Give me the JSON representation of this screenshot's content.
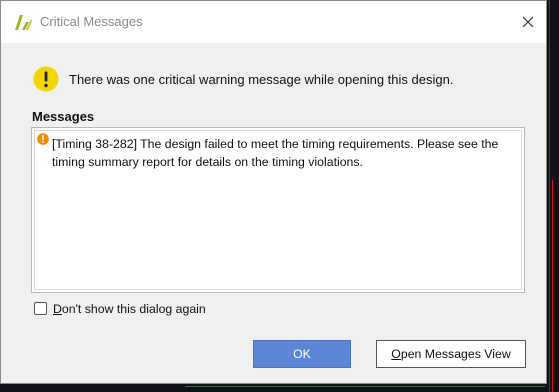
{
  "window": {
    "title": "Critical Messages",
    "close_icon": "close-icon",
    "logo_icon": "vivado-logo-icon"
  },
  "summary": {
    "icon": "warning-icon",
    "text": "There was one critical warning message while opening this design."
  },
  "messages": {
    "heading": "Messages",
    "items": [
      {
        "icon": "critical-warning-icon",
        "text": "[Timing 38-282] The design failed to meet the timing requirements. Please see the timing summary report for details on the timing violations."
      }
    ]
  },
  "dont_show": {
    "checked": false,
    "mnemonic": "D",
    "label_rest": "on't show this dialog again"
  },
  "buttons": {
    "ok_label": "OK",
    "open_mnemonic": "O",
    "open_label_rest": "pen Messages View"
  },
  "colors": {
    "dialog_bg": "#f0f0f0",
    "ok_button": "#5b87d6",
    "warning_yellow": "#f2d600",
    "critical_orange": "#f08a00",
    "logo_green": "#9ab81e"
  }
}
